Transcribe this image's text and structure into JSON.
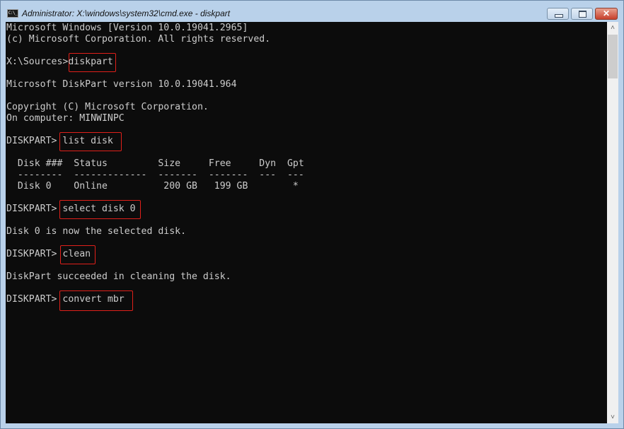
{
  "window": {
    "title": "Administrator: X:\\windows\\system32\\cmd.exe - diskpart",
    "icon": "cmd-icon",
    "icon_text": "C:\\_",
    "controls": {
      "minimize": "minimize",
      "maximize": "maximize",
      "close": "✕"
    }
  },
  "console": {
    "lines": [
      "Microsoft Windows [Version 10.0.19041.2965]",
      "(c) Microsoft Corporation. All rights reserved.",
      "",
      "X:\\Sources>diskpart",
      "",
      "Microsoft DiskPart version 10.0.19041.964",
      "",
      "Copyright (C) Microsoft Corporation.",
      "On computer: MINWINPC",
      "",
      "DISKPART> list disk",
      "",
      "  Disk ###  Status         Size     Free     Dyn  Gpt",
      "  --------  -------------  -------  -------  ---  ---",
      "  Disk 0    Online          200 GB   199 GB        *",
      "",
      "DISKPART> select disk 0",
      "",
      "Disk 0 is now the selected disk.",
      "",
      "DISKPART> clean",
      "",
      "DiskPart succeeded in cleaning the disk.",
      "",
      "DISKPART> convert mbr"
    ],
    "highlighted_commands": [
      "diskpart",
      "list disk",
      "select disk 0",
      "clean",
      "convert mbr"
    ],
    "highlight_color": "#e0201a",
    "text_color": "#cccccc",
    "background_color": "#0c0c0c"
  },
  "scrollbar": {
    "up": "˄",
    "down": "˅"
  }
}
